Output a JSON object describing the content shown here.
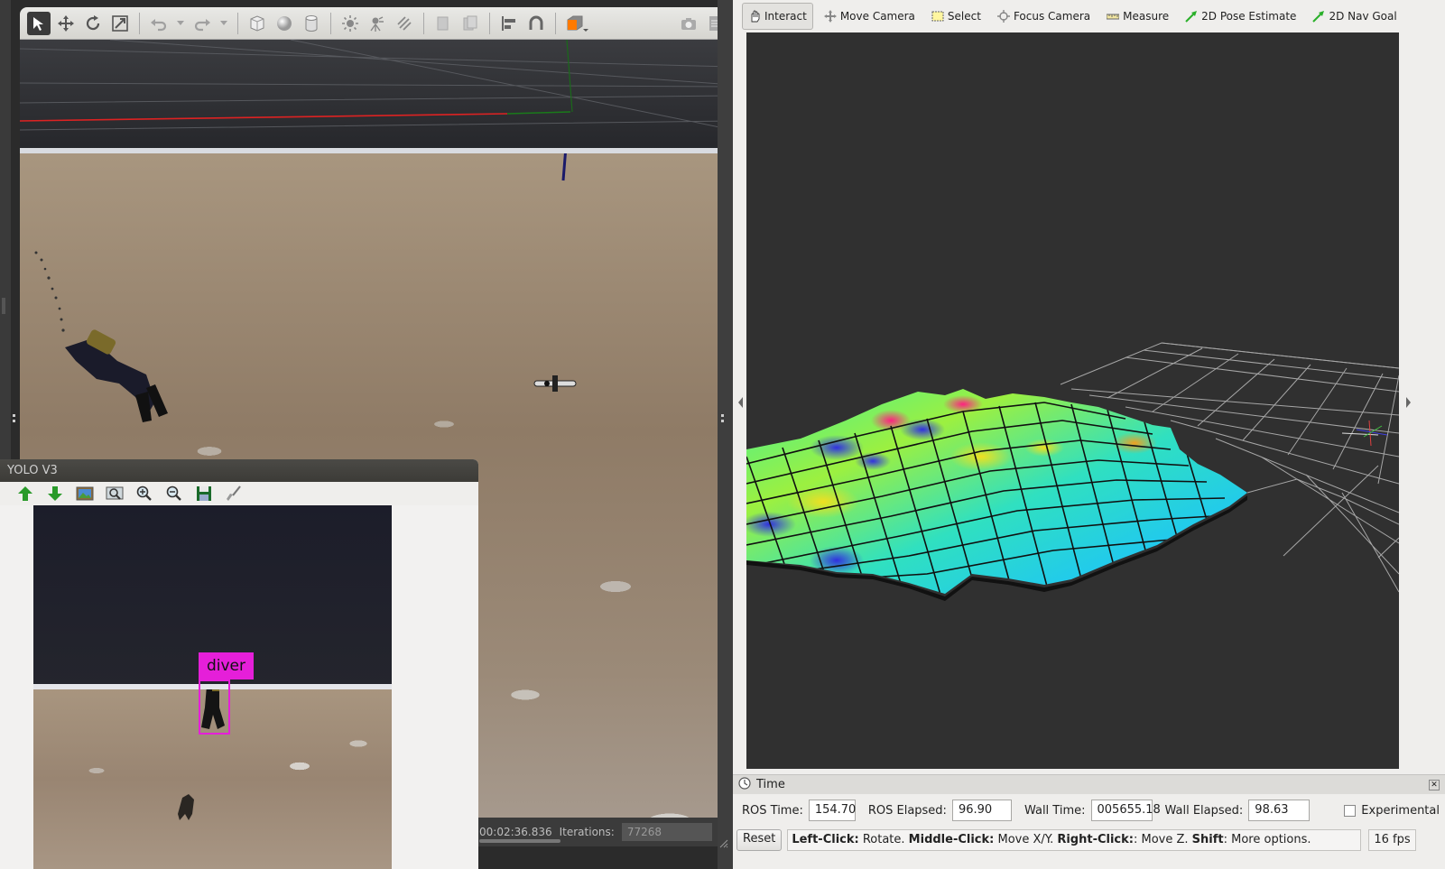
{
  "gazebo": {
    "toolbar_icons": [
      "select-arrow-icon",
      "translate-icon",
      "rotate-icon",
      "scale-icon",
      "undo-icon",
      "undo-dropdown-icon",
      "redo-icon",
      "redo-dropdown-icon",
      "box-shape-icon",
      "sphere-shape-icon",
      "cylinder-shape-icon",
      "point-light-icon",
      "spot-light-icon",
      "directional-light-icon",
      "copy-icon",
      "paste-icon",
      "align-icon",
      "snap-icon",
      "view-angle-icon",
      "screenshot-icon",
      "log-icon"
    ],
    "status": {
      "sim_time": "00:02:36.836",
      "iterations_label": "Iterations:",
      "iterations_value": "77268"
    }
  },
  "yolo": {
    "title": "YOLO V3",
    "toolbar_icons": [
      "up-arrow-icon",
      "down-arrow-icon",
      "image-icon",
      "zoom-fit-icon",
      "zoom-in-icon",
      "zoom-out-icon",
      "save-icon",
      "brush-icon"
    ],
    "detection_label": "diver"
  },
  "rviz": {
    "tools": [
      {
        "label": "Interact",
        "icon": "hand-icon",
        "active": true
      },
      {
        "label": "Move Camera",
        "icon": "move-camera-icon",
        "active": false
      },
      {
        "label": "Select",
        "icon": "select-rect-icon",
        "active": false
      },
      {
        "label": "Focus Camera",
        "icon": "focus-camera-icon",
        "active": false
      },
      {
        "label": "Measure",
        "icon": "ruler-icon",
        "active": false
      },
      {
        "label": "2D Pose Estimate",
        "icon": "pose-arrow-icon",
        "active": false
      },
      {
        "label": "2D Nav Goal",
        "icon": "nav-goal-icon",
        "active": false
      }
    ],
    "time_panel": {
      "title": "Time",
      "ros_time_label": "ROS Time:",
      "ros_time": "154.70",
      "ros_elapsed_label": "ROS Elapsed:",
      "ros_elapsed": "96.90",
      "wall_time_label": "Wall Time:",
      "wall_time": "005655.18",
      "wall_elapsed_label": "Wall Elapsed:",
      "wall_elapsed": "98.63",
      "experimental_label": "Experimental"
    },
    "status": {
      "reset_label": "Reset",
      "hint_parts": [
        {
          "b": "Left-Click:",
          "t": " Rotate. "
        },
        {
          "b": "Middle-Click:",
          "t": " Move X/Y. "
        },
        {
          "b": "Right-Click:",
          "t": ": Move Z. "
        },
        {
          "b": "Shift",
          "t": ": More options."
        }
      ],
      "fps": "16 fps"
    },
    "colors": {
      "background": "#303030",
      "grid": "#a0a0a0"
    }
  }
}
